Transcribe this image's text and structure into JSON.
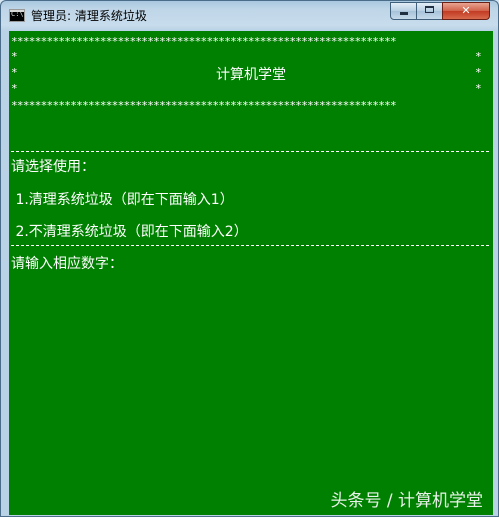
{
  "window": {
    "title": "管理员:  清理系统垃圾",
    "icon": "console-icon",
    "controls": {
      "minimize_label": "",
      "maximize_label": "",
      "close_label": "✕"
    }
  },
  "console": {
    "background": "#008000",
    "foreground": "#ffffff",
    "star_row": "*****************************************************************",
    "star_edge": "*",
    "heading": "计算机学堂",
    "prompt_choose": "请选择使用：",
    "option_1": " 1.清理系统垃圾（即在下面输入1）",
    "option_2": " 2.不清理系统垃圾（即在下面输入2）",
    "prompt_input": "请输入相应数字："
  },
  "watermark": "头条号 / 计算机学堂"
}
